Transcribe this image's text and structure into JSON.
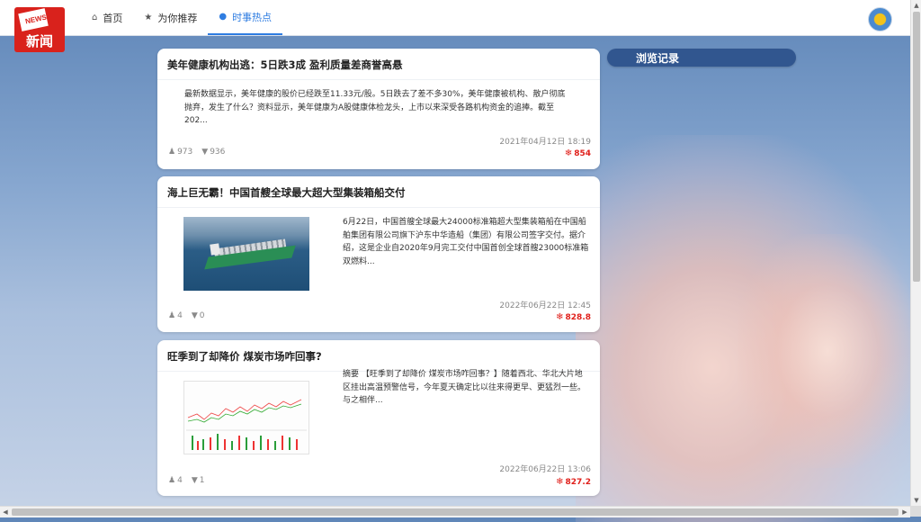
{
  "logo": {
    "badge_text": "NEWS",
    "title": "新闻"
  },
  "nav": {
    "items": [
      {
        "label": "首页",
        "icon": "home-icon",
        "active": false
      },
      {
        "label": "为你推荐",
        "icon": "star-icon",
        "active": false
      },
      {
        "label": "时事热点",
        "icon": "dot-icon",
        "active": true
      }
    ]
  },
  "sidebar": {
    "browse_history_label": "浏览记录"
  },
  "articles": [
    {
      "title": "美年健康机构出逃：5日跌3成 盈利质量差商誉高悬",
      "summary": "最新数据显示，美年健康的股价已经跌至11.33元/股。5日跌去了差不多30%，美年健康被机构、散户彻底抛弃，发生了什么？资料显示，美年健康为A股健康体检龙头，上市以来深受各路机构资金的追捧。截至202...",
      "date": "2021年04月12日 18:19",
      "likes": "973",
      "dislikes": "936",
      "hot": "854",
      "image": "none"
    },
    {
      "title": "海上巨无霸！中国首艘全球最大超大型集装箱船交付",
      "summary": "6月22日，中国首艘全球最大24000标准箱超大型集装箱船在中国船舶集团有限公司旗下沪东中华造船（集团）有限公司签字交付。据介绍，这是企业自2020年9月完工交付中国首创全球首艘23000标准箱双燃料...",
      "date": "2022年06月22日 12:45",
      "likes": "4",
      "dislikes": "0",
      "hot": "828.8",
      "image": "container-ship-photo"
    },
    {
      "title": "旺季到了却降价 煤炭市场咋回事?",
      "summary": "摘要 【旺季到了却降价 煤炭市场咋回事？】随着西北、华北大片地区挂出高温预警信号，今年夏天确定比以往来得更早、更猛烈一些。与之相伴...",
      "date": "2022年06月22日 13:06",
      "likes": "4",
      "dislikes": "1",
      "hot": "827.2",
      "image": "stock-chart-image"
    }
  ],
  "colors": {
    "accent": "#2f7de1",
    "hot": "#e0201b",
    "browse_bg": "#31568f",
    "logo_red": "#d9221c"
  }
}
